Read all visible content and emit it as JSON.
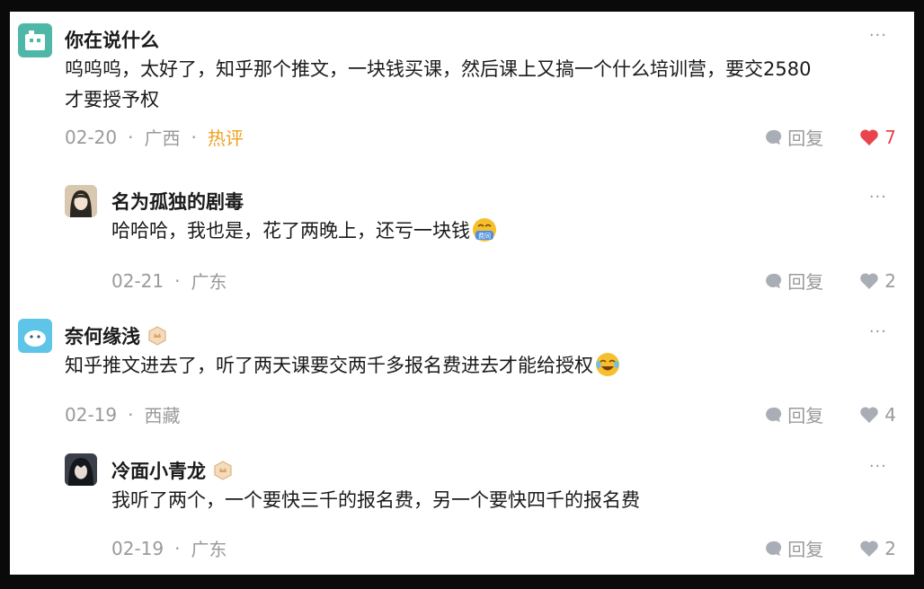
{
  "colors": {
    "hot": "#f0a020",
    "like_active": "#e8444e",
    "meta": "#9a9a9a"
  },
  "comments": [
    {
      "user": "你在说什么",
      "text_lines": [
        "呜呜呜，太好了，知乎那个推文，一块钱买课，然后课上又搞一个什么培训营，要交2580",
        "才要授予权"
      ],
      "date": "02-20",
      "location": "广西",
      "tag": "热评",
      "reply_label": "回复",
      "likes": "7",
      "more": "···"
    },
    {
      "user": "名为孤独的剧毒",
      "text": "哈哈哈，我也是，花了两晚上，还亏一块钱",
      "emoji_label": "费同",
      "date": "02-21",
      "location": "广东",
      "reply_label": "回复",
      "likes": "2",
      "more": "···"
    },
    {
      "user": "奈何缘浅",
      "text": "知乎推文进去了，听了两天课要交两千多报名费进去才能给授权",
      "date": "02-19",
      "location": "西藏",
      "reply_label": "回复",
      "likes": "4",
      "more": "···"
    },
    {
      "user": "冷面小青龙",
      "text": "我听了两个，一个要快三千的报名费，另一个要快四千的报名费",
      "date": "02-19",
      "location": "广东",
      "reply_label": "回复",
      "likes": "2",
      "more": "···"
    }
  ]
}
